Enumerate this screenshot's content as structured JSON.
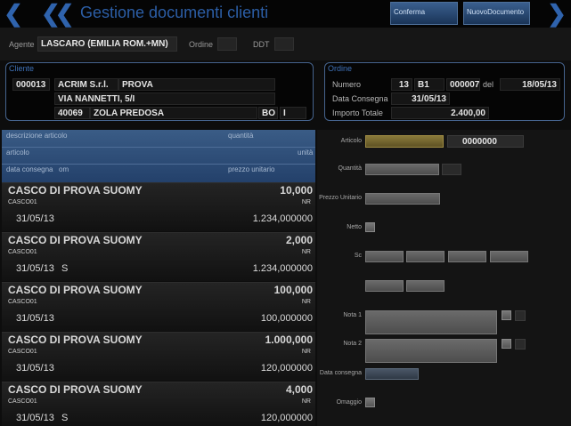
{
  "header": {
    "title": "Gestione documenti clienti",
    "back_icon": "chevron-left",
    "first_icon": "double-chevron-left",
    "forward_icon": "chevron-right",
    "confirm_label": "Conferma",
    "new_doc_label": "NuovoDocumento"
  },
  "agent_row": {
    "agent_label": "Agente",
    "agent_value": "LASCARO (EMILIA ROM.+MN)",
    "order_label": "Ordine",
    "order_value": "",
    "ddt_label": "DDT",
    "ddt_value": ""
  },
  "cliente": {
    "title": "Cliente",
    "code": "000013",
    "name": "ACRIM S.r.l.",
    "name2": "PROVA",
    "address": "VIA NANNETTI, 5/I",
    "cap": "40069",
    "city": "ZOLA PREDOSA",
    "province": "BO",
    "country": "I"
  },
  "ordine": {
    "title": "Ordine",
    "numero_label": "Numero",
    "numero_value": "13",
    "serie": "B1",
    "doc_number": "000007",
    "del_label": "del",
    "date": "18/05/13",
    "data_consegna_label": "Data Consegna",
    "data_consegna_value": "31/05/13",
    "importo_label": "Importo Totale",
    "importo_value": "2.400,00"
  },
  "list_header": {
    "descrizione": "descrizione articolo",
    "quantita": "quantità",
    "articolo": "articolo",
    "unita": "unità",
    "data_consegna": "data consegna",
    "om": "om",
    "prezzo_unitario": "prezzo unitario"
  },
  "rows": [
    {
      "title": "CASCO DI PROVA SUOMY",
      "qty": "10,000",
      "code": "CASCO01",
      "um": "NR",
      "date": "31/05/13",
      "flag": "",
      "price": "1.234,000000"
    },
    {
      "title": "CASCO DI PROVA SUOMY",
      "qty": "2,000",
      "code": "CASCO01",
      "um": "NR",
      "date": "31/05/13",
      "flag": "S",
      "price": "1.234,000000"
    },
    {
      "title": "CASCO DI PROVA SUOMY",
      "qty": "100,000",
      "code": "CASCO01",
      "um": "NR",
      "date": "31/05/13",
      "flag": "",
      "price": "100,000000"
    },
    {
      "title": "CASCO DI PROVA SUOMY",
      "qty": "1.000,000",
      "code": "CASCO01",
      "um": "NR",
      "date": "31/05/13",
      "flag": "",
      "price": "120,000000"
    },
    {
      "title": "CASCO DI PROVA SUOMY",
      "qty": "4,000",
      "code": "CASCO01",
      "um": "NR",
      "date": "31/05/13",
      "flag": "S",
      "price": "120,000000"
    }
  ],
  "detail": {
    "articolo_label": "Articolo",
    "articolo_value": "0000000",
    "quantita_label": "Quantità",
    "prezzo_label": "Prezzo Unitario",
    "netto_label": "Netto",
    "sc_label": "Sc",
    "nota1_label": "Nota 1",
    "nota2_label": "Nota 2",
    "data_consegna_label": "Data consegna",
    "omaggio_label": "Omaggio"
  },
  "colors": {
    "accent": "#2c5ea6",
    "panel_border": "#46648e",
    "list_header_bg": "#2f5079",
    "highlight_field": "#8a7a3a"
  }
}
